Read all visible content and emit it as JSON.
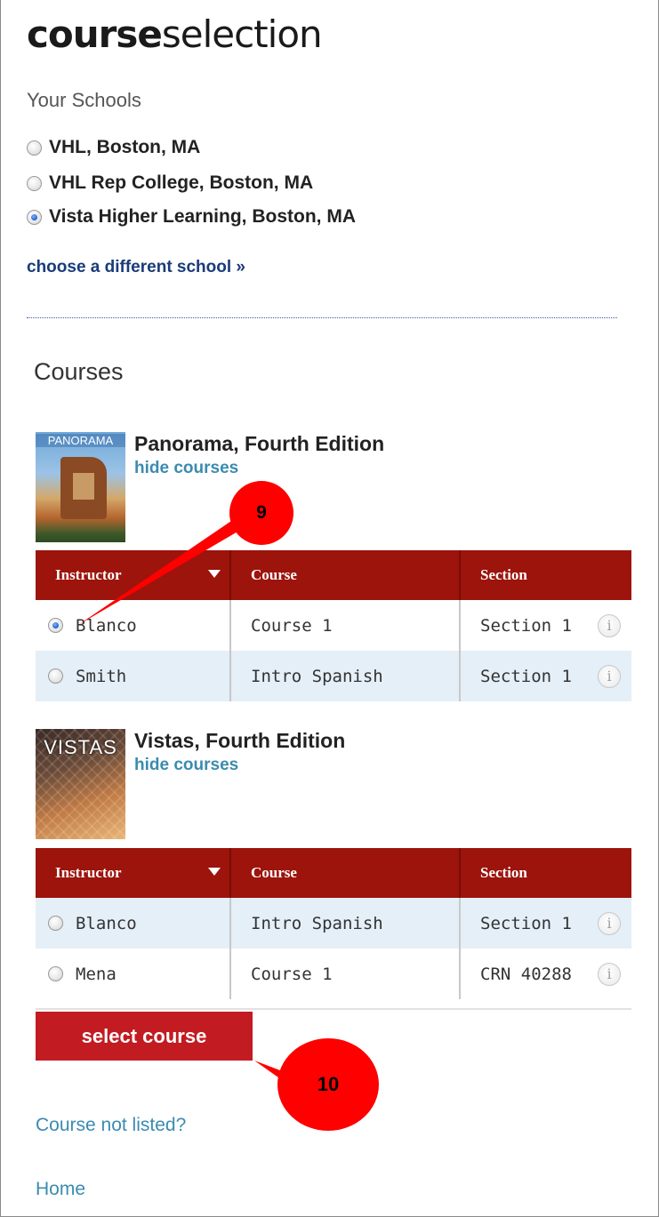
{
  "header": {
    "title_bold": "course",
    "title_light": "selection"
  },
  "schools": {
    "heading": "Your Schools",
    "items": [
      {
        "label": "VHL, Boston, MA",
        "selected": false
      },
      {
        "label": "VHL Rep College, Boston, MA",
        "selected": false
      },
      {
        "label": "Vista Higher Learning, Boston, MA",
        "selected": true
      }
    ],
    "choose_link": "choose a different school »"
  },
  "courses": {
    "heading": "Courses",
    "columns": [
      "Instructor",
      "Course",
      "Section"
    ],
    "books": [
      {
        "cover_text": "PANORAMA",
        "title": "Panorama, Fourth Edition",
        "hide_label": "hide courses",
        "rows": [
          {
            "instructor": "Blanco",
            "course": "Course 1",
            "section": "Section 1",
            "selected": true
          },
          {
            "instructor": "Smith",
            "course": "Intro Spanish",
            "section": "Section 1",
            "selected": false
          }
        ]
      },
      {
        "cover_text": "VISTAS",
        "title": "Vistas, Fourth Edition",
        "hide_label": "hide courses",
        "rows": [
          {
            "instructor": "Blanco",
            "course": "Intro Spanish",
            "section": "Section 1",
            "selected": false
          },
          {
            "instructor": "Mena",
            "course": "Course 1",
            "section": "CRN 40288",
            "selected": false
          }
        ]
      }
    ]
  },
  "actions": {
    "select_course": "select course"
  },
  "footer": {
    "not_listed": "Course not listed?",
    "home": "Home"
  },
  "annotations": {
    "callout_9": "9",
    "callout_10": "10"
  },
  "colors": {
    "header_red": "#9c140c",
    "button_red": "#c21b22",
    "link_blue": "#3b8bb0",
    "row_alt": "#e4eff8",
    "callout_red": "#ff0000"
  },
  "icons": {
    "info": "i"
  }
}
